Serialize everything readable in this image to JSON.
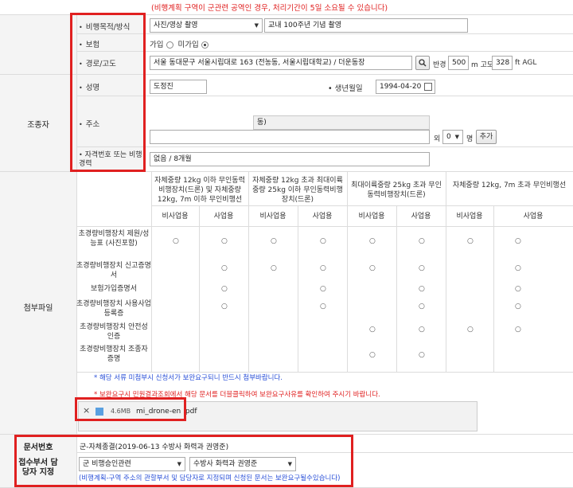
{
  "top_notice": "(비행계획 구역이 군관련 공역인 경우, 처리기간이 5일 소요될 수 있습니다)",
  "fields": {
    "purpose_label": "비행목적/방식",
    "purpose_select": "사진/영상 촬영",
    "purpose_detail": "교내 100주년 기념 촬영",
    "insurance_label": "보험",
    "insurance_yes": "가입",
    "insurance_no": "미가입",
    "route_label": "경로/고도",
    "route_address": "서울 동대문구 서울시립대로 163 (전농동, 서울시립대학교) / 더운동장",
    "radius_label": "반경",
    "radius_value": "500",
    "altitude_unit_label": "m 고도",
    "altitude_value": "328",
    "altitude_unit": "ft AGL"
  },
  "pilot": {
    "section_label": "조종자",
    "name_label": "성명",
    "name_value": "도정진",
    "birth_label": "생년월일",
    "birth_value": "1994-04-20",
    "address_label": "주소",
    "address_line1": "동)",
    "address_extra_label": "외",
    "address_count": "0",
    "address_count_unit": "명",
    "add_button": "추가",
    "license_label": "자격번호 또는 비행경력",
    "license_value": "없음 / 8개월"
  },
  "attachments": {
    "section_label": "첨부파일",
    "col_groups": [
      "자체중량 12kg 이하 무인동력비행장치(드론) 및 자체중량 12kg, 7m 이하 무인비행선",
      "자체중량 12kg 초과 최대이륙중량 25kg 이하 무인동력비행장치(드론)",
      "최대이륙중량 25kg 초과 무인동력비행장치(드론)",
      "자체중량 12kg, 7m 초과 무인비행선"
    ],
    "sub_cols": [
      "비사업용",
      "사업용",
      "비사업용",
      "사업용",
      "비사업용",
      "사업용",
      "비사업용",
      "사업용"
    ],
    "rows": [
      {
        "label": "초경량비행장치 제원/성능표 (사진포함)",
        "marks": [
          "○",
          "○",
          "○",
          "○",
          "○",
          "○",
          "○",
          "○"
        ]
      },
      {
        "label": "초경량비행장치 신고증명서",
        "marks": [
          "",
          "○",
          "○",
          "○",
          "○",
          "○",
          "",
          "○"
        ]
      },
      {
        "label": "보험가입증명서",
        "marks": [
          "",
          "○",
          "",
          "○",
          "",
          "○",
          "",
          "○"
        ]
      },
      {
        "label": "초경량비행장치 사용사업등록증",
        "marks": [
          "",
          "○",
          "",
          "○",
          "",
          "○",
          "",
          "○"
        ]
      },
      {
        "label": "초경량비행장치 안전성 인증",
        "marks": [
          "",
          "",
          "",
          "",
          "○",
          "○",
          "○",
          "○"
        ]
      },
      {
        "label": "초경량비행장치 조종자 증명",
        "marks": [
          "",
          "",
          "",
          "",
          "○",
          "○",
          "",
          ""
        ]
      }
    ],
    "note_required": "* 해당 서류 미첨부시 신청서가 보완요구되니 반드시 첨부바랍니다.",
    "note_supplement": "* 보완요구시 민원결과조회에서 해당 문서를 더블클릭하여 보완요구사유를 확인하여 주시기 바랍니다.",
    "file_size": "4.6MB",
    "file_name": "mi_drone-en .pdf",
    "remove_icon": "×"
  },
  "doc": {
    "number_label": "문서번호",
    "number_value": "군-자체종결(2019-06-13 수방사 화력과 권영준)",
    "dept_label": "접수부서 담당자 지정",
    "dept_select": "군 비행승인관련",
    "officer_select": "수방사 화력과 권영준",
    "dept_note": "(비행계획-구역 주소의 관할부서 및 담당자로 지정되며 신청된 문서는 보완요구될수있습니다)"
  },
  "colors": {
    "highlight_box": "#e02020",
    "red_note": "#e02020",
    "blue_note": "#2a50d8",
    "label_bg": "#f4f4f4"
  }
}
